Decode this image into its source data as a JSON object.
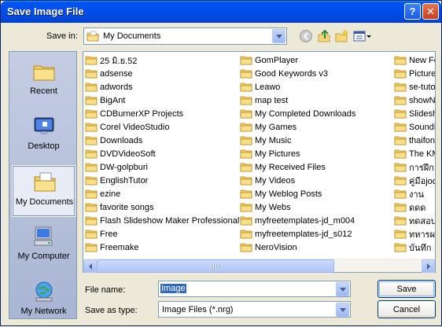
{
  "window": {
    "title": "Save Image File",
    "help_glyph": "?",
    "close_glyph": "✕"
  },
  "savein": {
    "label": "Save in:",
    "value": "My Documents",
    "icons": [
      "my-documents-icon",
      "back-icon",
      "up-folder-icon",
      "new-folder-icon",
      "view-menu-icon"
    ]
  },
  "places": [
    {
      "label": "Recent",
      "icon": "recent-icon"
    },
    {
      "label": "Desktop",
      "icon": "desktop-icon"
    },
    {
      "label": "My Documents",
      "icon": "my-documents-icon",
      "selected": true
    },
    {
      "label": "My Computer",
      "icon": "my-computer-icon"
    },
    {
      "label": "My Network",
      "icon": "my-network-icon"
    }
  ],
  "files": {
    "col1": [
      "25 มิ.ย.52",
      "adsense",
      "adwords",
      "BigAnt",
      "CDBurnerXP Projects",
      "Corel VideoStudio",
      "Downloads",
      "DVDVideoSoft",
      "DW-golpburi",
      "EnglishTutor",
      "ezine",
      "favorite songs",
      "Flash Slideshow Maker Professional",
      "Free",
      "Freemake"
    ],
    "col2": [
      "GomPlayer",
      "Good Keywords v3",
      "Leawo",
      "map test",
      "My Completed Downloads",
      "My Games",
      "My Music",
      "My Pictures",
      "My Received Files",
      "My Videos",
      "My Weblog Posts",
      "My Webs",
      "myfreetemplates-jd_m004",
      "myfreetemplates-jd_s012",
      "NeroVision"
    ],
    "col3": [
      "New Fo",
      "Picture",
      "se-tuto",
      "showNe",
      "Slidesh",
      "SoundB",
      "thaifon",
      "The KM",
      "การฝึก",
      "คู่มือjoo",
      "งาน",
      "ดดด",
      "ทดสอบ",
      "ทหารผ",
      "บันทึก"
    ]
  },
  "filename": {
    "label": "File name:",
    "value": "Image"
  },
  "savetype": {
    "label": "Save as type:",
    "value": "Image Files (*.nrg)"
  },
  "buttons": {
    "save": "Save",
    "cancel": "Cancel"
  }
}
